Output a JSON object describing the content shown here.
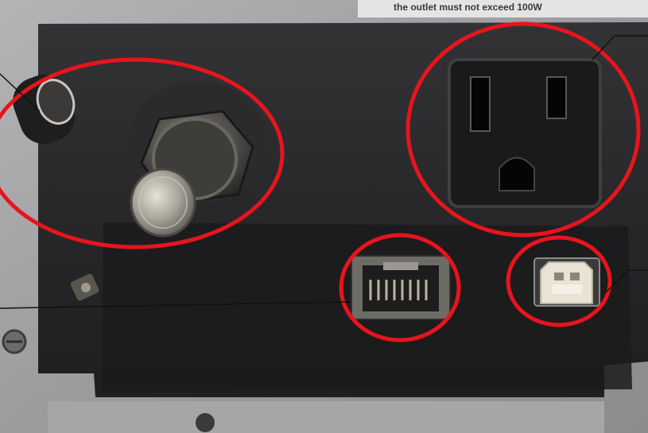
{
  "top_label": {
    "text": "the outlet must not exceed 100W"
  },
  "callouts": [
    {
      "name": "pneumatic-connectors",
      "highlighted": true
    },
    {
      "name": "ac-power-outlet",
      "highlighted": true
    },
    {
      "name": "ethernet-port",
      "highlighted": true
    },
    {
      "name": "usb-b-port",
      "highlighted": true
    }
  ],
  "colors": {
    "highlight_ring": "#e8141c",
    "leader_line": "#111111",
    "panel": "#2a2a2c",
    "chassis": "#a3a3a5"
  }
}
